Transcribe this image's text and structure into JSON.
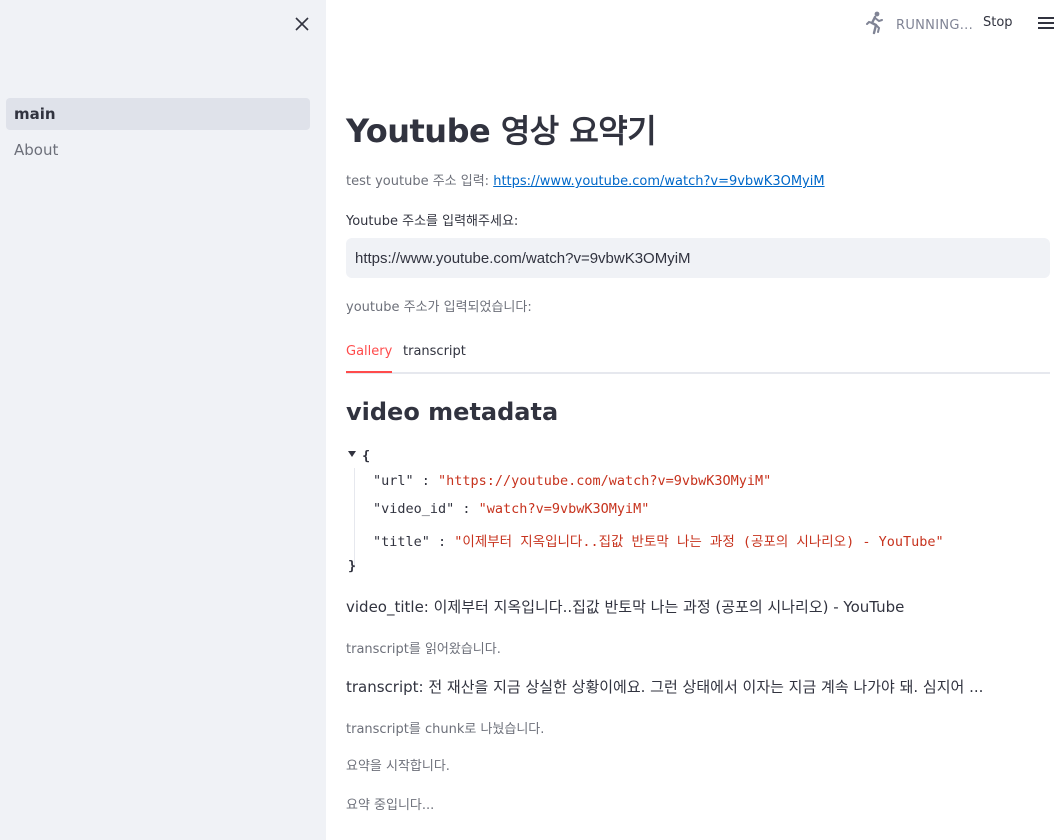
{
  "sidebar": {
    "close_icon": "close-icon",
    "items": [
      {
        "label": "main",
        "active": true
      },
      {
        "label": "About",
        "active": false
      }
    ]
  },
  "toolbar": {
    "status_icon": "running-person-icon",
    "status_text": "RUNNING...",
    "stop_label": "Stop",
    "menu_icon": "hamburger-menu-icon"
  },
  "main": {
    "title": "Youtube 영상 요약기",
    "test_prefix": "test youtube 주소 입력:",
    "test_link": "https://www.youtube.com/watch?v=9vbwK3OMyiM",
    "input_label": "Youtube 주소를 입력해주세요:",
    "input_value": "https://www.youtube.com/watch?v=9vbwK3OMyiM",
    "caption_entered": "youtube 주소가 입력되었습니다:",
    "tabs": [
      {
        "label": "Gallery",
        "active": true
      },
      {
        "label": "transcript",
        "active": false
      }
    ],
    "section_title": "video metadata",
    "json": {
      "open_brace": "{",
      "close_brace": "}",
      "rows": [
        {
          "key": "\"url\"",
          "sep": " : ",
          "value": "\"https://youtube.com/watch?v=9vbwK3OMyiM\""
        },
        {
          "key": "\"video_id\"",
          "sep": " : ",
          "value": "\"watch?v=9vbwK3OMyiM\""
        },
        {
          "key": "\"title\"",
          "sep": " : ",
          "value": "\"이제부터 지옥입니다..집값 반토막 나는 과정 (공포의 시나리오) - YouTube\""
        }
      ]
    },
    "video_title_line": "video_title: 이제부터 지옥입니다..집값 반토막 나는 과정 (공포의 시나리오) - YouTube",
    "caption_read": "transcript를 읽어왔습니다.",
    "transcript_line": "transcript: 전 재산을 지금 상실한 상황이에요. 그런 상태에서 이자는 지금 계속 나가야 돼. 심지어 ...",
    "caption_chunk": "transcript를 chunk로 나눴습니다.",
    "caption_start": "요약을 시작합니다.",
    "caption_progress": "요약 중입니다..."
  },
  "colors": {
    "accent": "#ff4b4b",
    "link": "#0068c9",
    "sidebar_bg": "#f0f2f6",
    "json_string": "#c7331e"
  }
}
